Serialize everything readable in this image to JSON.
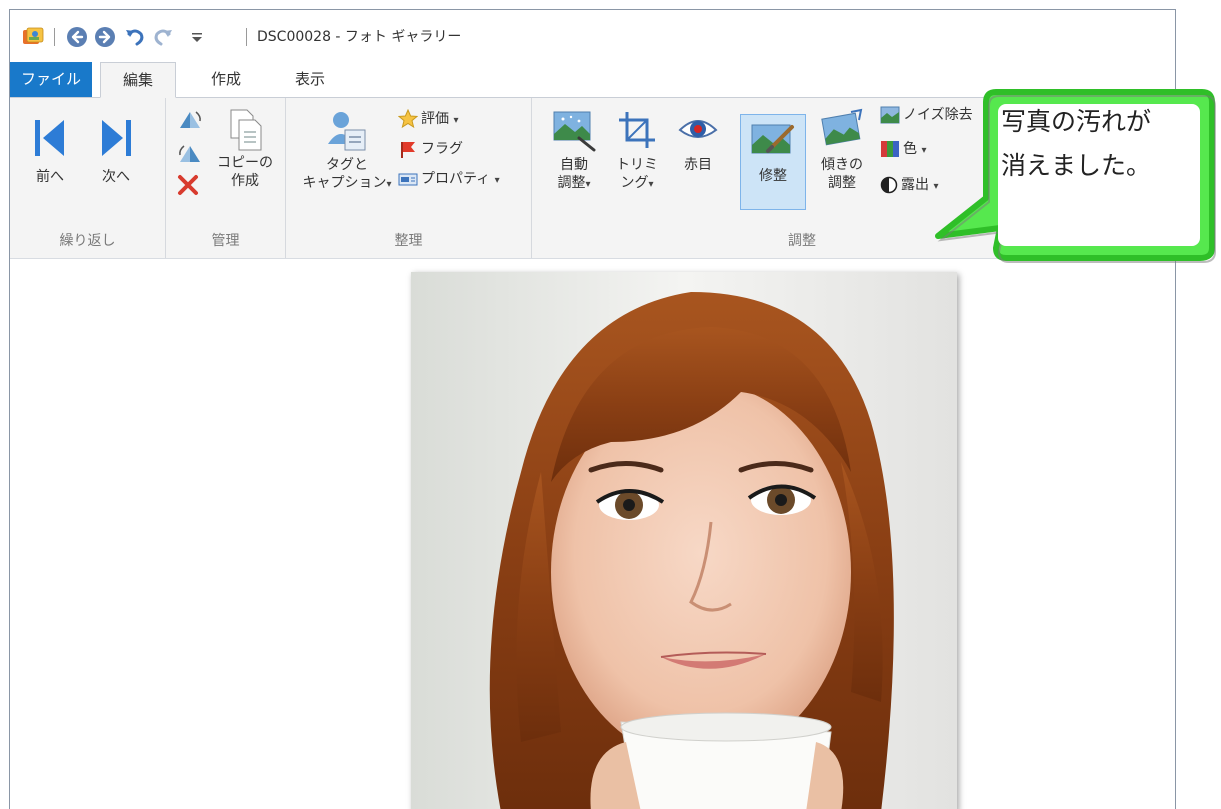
{
  "window": {
    "title": "DSC00028 - フォト ギャラリー"
  },
  "tabs": [
    {
      "label": "ファイル"
    },
    {
      "label": "編集"
    },
    {
      "label": "作成"
    },
    {
      "label": "表示"
    }
  ],
  "ribbon": {
    "groups": {
      "repeat": {
        "label": "繰り返し",
        "prev": "前へ",
        "next": "次へ"
      },
      "manage": {
        "label": "管理",
        "copy_line1": "コピーの",
        "copy_line2": "作成"
      },
      "organize": {
        "label": "整理",
        "tag_line1": "タグと",
        "tag_line2": "キャプション",
        "rating": "評価",
        "flag": "フラグ",
        "properties": "プロパティ"
      },
      "adjust": {
        "label": "調整",
        "auto_line1": "自動",
        "auto_line2": "調整",
        "crop_line1": "トリミ",
        "crop_line2": "ング",
        "redeye": "赤目",
        "retouch": "修整",
        "straighten_line1": "傾きの",
        "straighten_line2": "調整",
        "noise": "ノイズ除去",
        "color": "色",
        "exposure": "露出"
      }
    },
    "dropdown_glyph": "▾"
  },
  "callout": {
    "line1": "写真の汚れが",
    "line2": "消えました。"
  },
  "colors": {
    "file_tab": "#1979ca",
    "selected_button": "#cde4f7",
    "callout_fill": "#44ff44",
    "callout_border": "#22cc22"
  }
}
